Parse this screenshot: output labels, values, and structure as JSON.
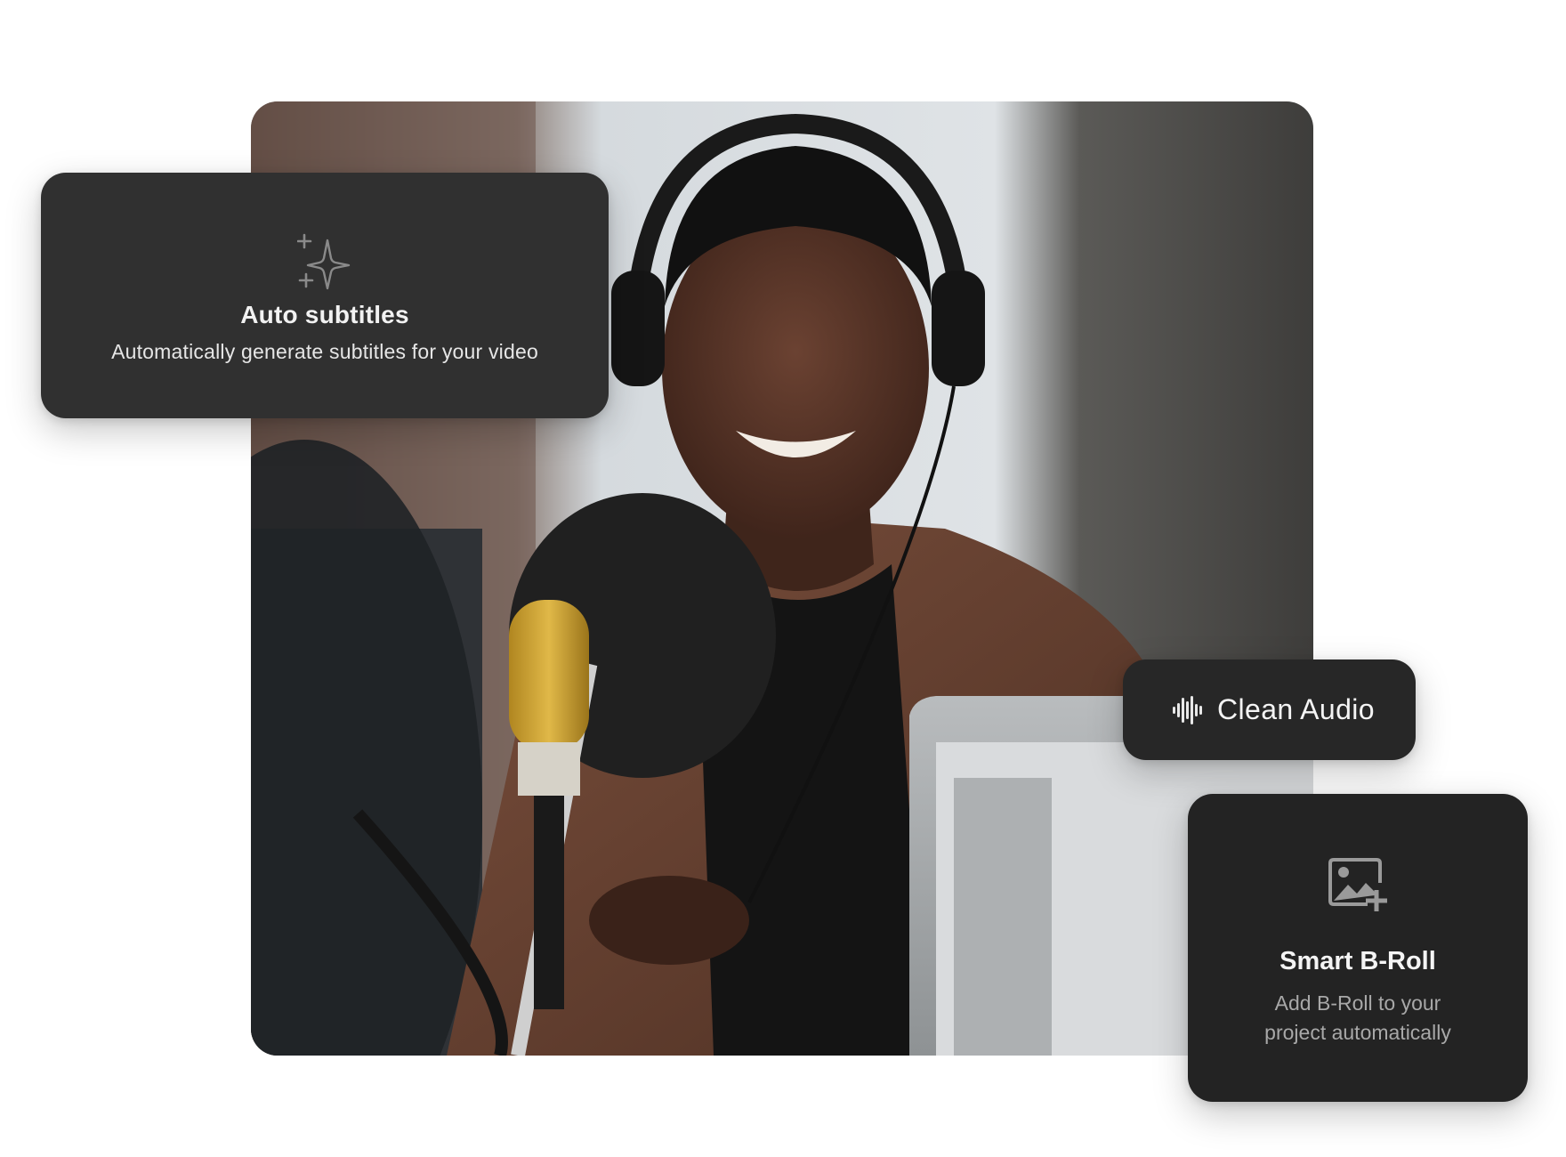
{
  "photo": {
    "subject": "smiling-person-with-headphones-and-microphone-icon"
  },
  "features": {
    "auto_subtitles": {
      "icon": "sparkle-icon",
      "title": "Auto subtitles",
      "description": "Automatically generate subtitles for your video"
    },
    "clean_audio": {
      "icon": "sound-wave-icon",
      "label": "Clean Audio"
    },
    "smart_broll": {
      "icon": "image-add-icon",
      "title": "Smart B-Roll",
      "description": "Add B-Roll to your project automatically"
    }
  },
  "colors": {
    "card_dark": "#2b2b2b",
    "card_text": "#f2f2f2",
    "card_muted_text": "#a8a8a8"
  }
}
